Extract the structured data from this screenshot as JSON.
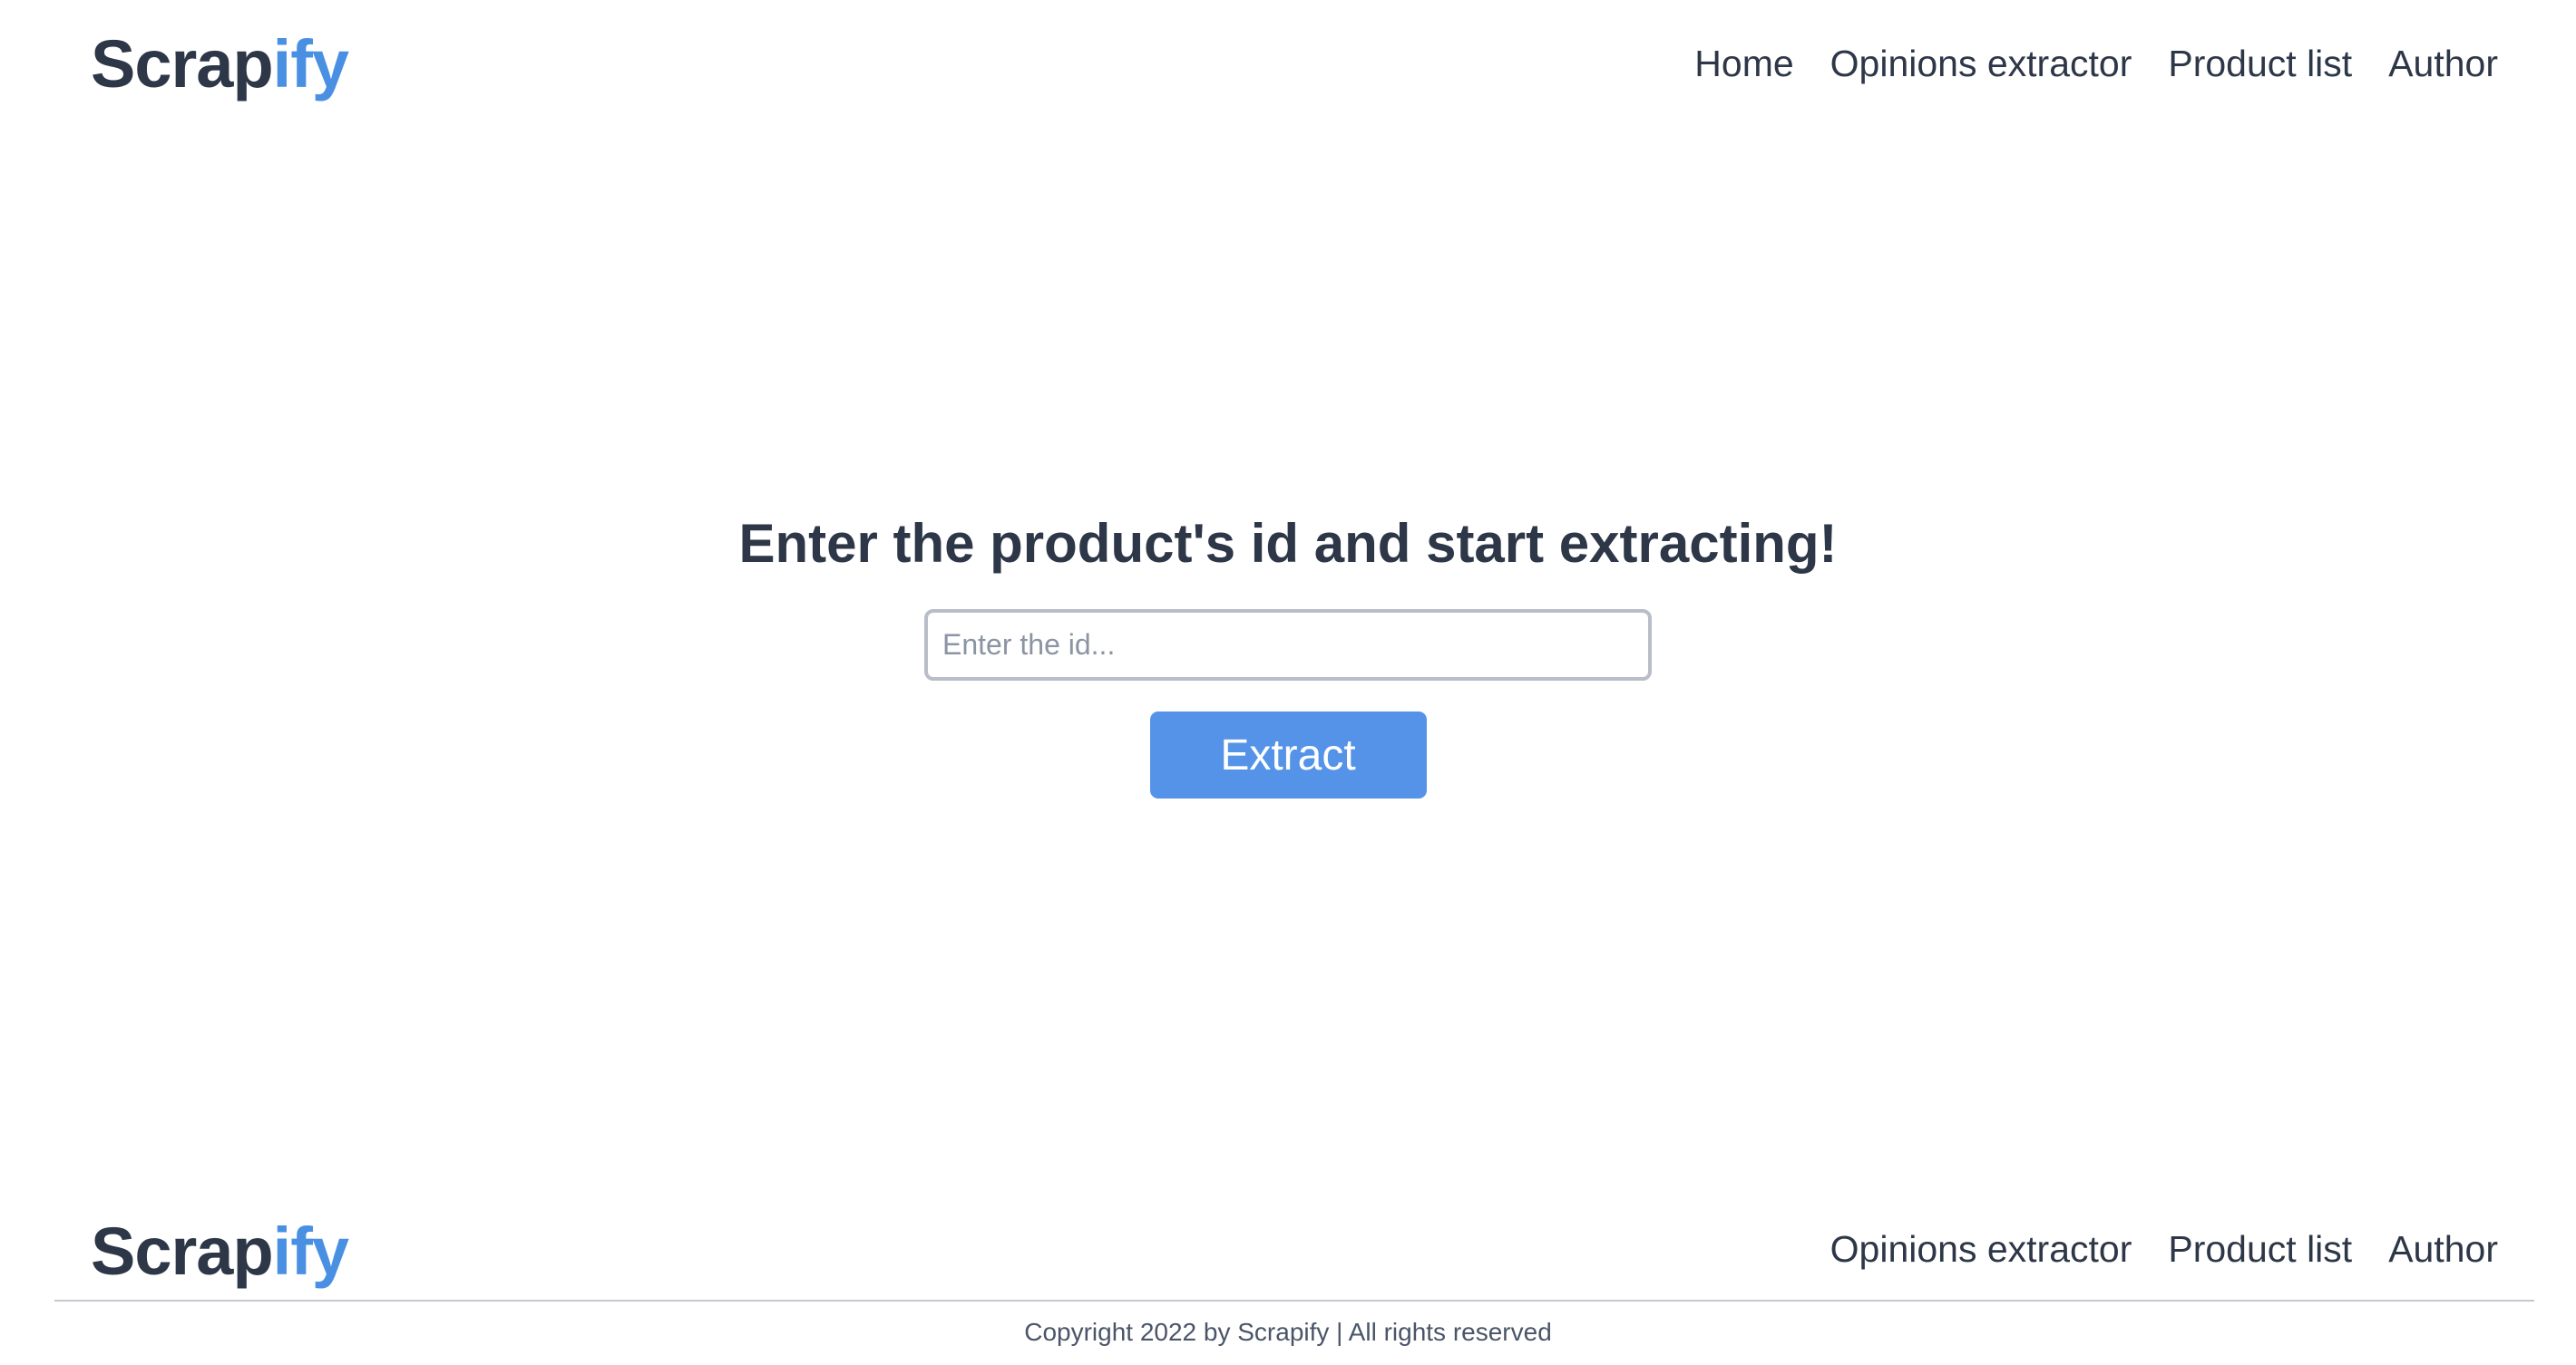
{
  "header": {
    "logo": {
      "part1": "Scrap",
      "part2": "ify"
    },
    "nav": [
      "Home",
      "Opinions extractor",
      "Product list",
      "Author"
    ]
  },
  "main": {
    "headline": "Enter the product's id and start extracting!",
    "input_placeholder": "Enter the id...",
    "input_value": "",
    "button_label": "Extract"
  },
  "footer": {
    "logo": {
      "part1": "Scrap",
      "part2": "ify"
    },
    "nav": [
      "Opinions extractor",
      "Product list",
      "Author"
    ],
    "copyright": "Copyright 2022 by Scrapify | All rights reserved"
  },
  "colors": {
    "text": "#2d3748",
    "accent": "#4a90e2",
    "button": "#5593e8",
    "input_border": "#b8bec9",
    "divider": "#c4c8cf"
  }
}
